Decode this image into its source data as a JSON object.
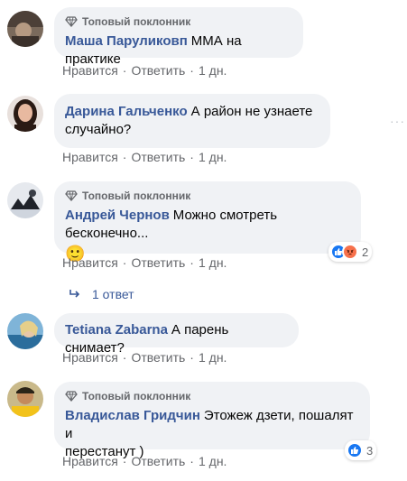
{
  "badge_label": "Топовый поклонник",
  "actions": {
    "like": "Нравится",
    "reply": "Ответить",
    "separator": "·"
  },
  "comments": [
    {
      "author": "Маша Паруликовп",
      "text": "ММА на практике",
      "time": "1 дн.",
      "top_fan": true
    },
    {
      "author": "Дарина Гальченко",
      "text_line1": "А район не узнаете",
      "text_line2": "случайно?",
      "time": "1 дн.",
      "top_fan": false
    },
    {
      "author": "Андрей Чернов",
      "text": "Можно смотреть бесконечно...",
      "emoji": "🙂",
      "time": "1 дн.",
      "top_fan": true,
      "reaction_count": "2"
    },
    {
      "author": "Tetiana Zabarna",
      "text": "А парень снимает?",
      "time": "1 дн.",
      "top_fan": false
    },
    {
      "author": "Владислав Гридчин",
      "text_line1": "Этожеж дзети, пошалят и",
      "text_line2": "перестанут )",
      "time": "1 дн.",
      "top_fan": true,
      "reaction_count": "3"
    }
  ],
  "replies_link": "1 ответ",
  "colors": {
    "author": "#385898",
    "bubble": "#f0f2f5",
    "meta": "#65676b",
    "like_blue": "#1877f2",
    "angry_orange": "#f7714c"
  },
  "icons": [
    "diamond-icon",
    "like-reaction-icon",
    "angry-reaction-icon",
    "reply-arrow-icon",
    "more-options-icon"
  ]
}
